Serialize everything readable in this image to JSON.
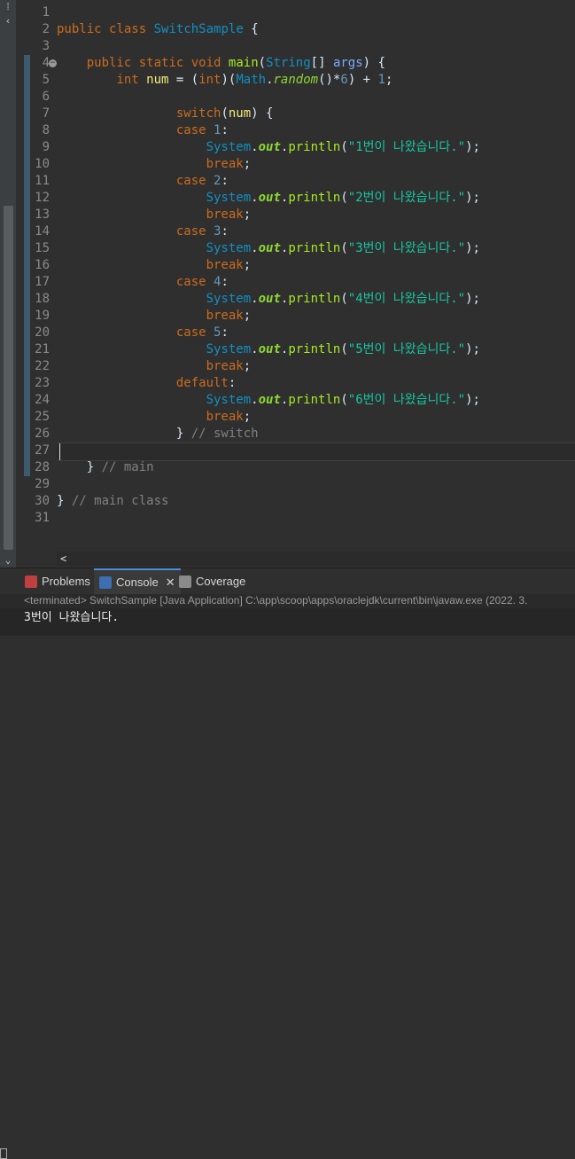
{
  "editor": {
    "line_numbers": [
      "1",
      "2",
      "3",
      "4",
      "5",
      "6",
      "7",
      "8",
      "9",
      "10",
      "11",
      "12",
      "13",
      "14",
      "15",
      "16",
      "17",
      "18",
      "19",
      "20",
      "21",
      "22",
      "23",
      "24",
      "25",
      "26",
      "27",
      "28",
      "29",
      "30",
      "31"
    ],
    "code": {
      "public_kw": "public",
      "class_kw": "class",
      "class_name": "SwitchSample",
      "open_brace": " {",
      "static_kw": "static",
      "void_kw": "void",
      "main_name": "main",
      "string_type": "String",
      "args_param": "args",
      "int_kw": "int",
      "num_var": "num",
      "math_class": "Math",
      "random_fn": "random",
      "six": "6",
      "one": "1",
      "switch_kw": "switch",
      "case_kw": "case",
      "default_kw": "default",
      "break_kw": "break",
      "system_class": "System",
      "out_field": "out",
      "println_fn": "println",
      "case_values": [
        "1",
        "2",
        "3",
        "4",
        "5"
      ],
      "messages": [
        "\"1번이 나왔습니다.\"",
        "\"2번이 나왔습니다.\"",
        "\"3번이 나왔습니다.\"",
        "\"4번이 나왔습니다.\"",
        "\"5번이 나왔습니다.\"",
        "\"6번이 나왔습니다.\""
      ],
      "comment_switch": "// switch",
      "comment_main": "// main",
      "comment_main_class": "// main class"
    }
  },
  "panel": {
    "tabs": [
      {
        "label": "Problems"
      },
      {
        "label": "Console"
      },
      {
        "label": "Coverage"
      }
    ],
    "status": "<terminated> SwitchSample [Java Application] C:\\app\\scoop\\apps\\oraclejdk\\current\\bin\\javaw.exe  (2022. 3.",
    "output": "3번이 나왔습니다."
  },
  "icons": {
    "fold": "collapse-marker-icon",
    "problems": "problems-icon",
    "console": "console-icon",
    "coverage": "coverage-icon",
    "close": "close-icon",
    "scroll_left": "scroll-left-arrow-icon",
    "scroll_up": "scroll-up-arrow-icon",
    "scroll_down": "scroll-down-arrow-icon"
  }
}
